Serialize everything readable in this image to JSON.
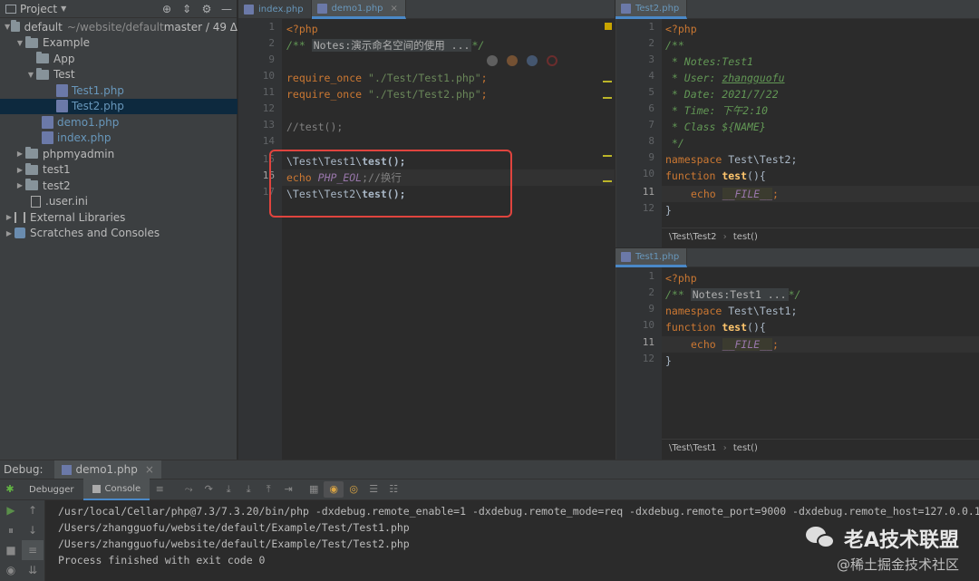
{
  "project": {
    "title": "Project",
    "tree": [
      {
        "label": "default",
        "extra": "~/website/default",
        "branch": "master / 49 Δ",
        "type": "folder",
        "expanded": true
      },
      {
        "label": "Example",
        "type": "folder",
        "expanded": true
      },
      {
        "label": "App",
        "type": "folder"
      },
      {
        "label": "Test",
        "type": "folder",
        "expanded": true
      },
      {
        "label": "Test1.php",
        "type": "php"
      },
      {
        "label": "Test2.php",
        "type": "php",
        "selected": true
      },
      {
        "label": "demo1.php",
        "type": "php"
      },
      {
        "label": "index.php",
        "type": "php"
      },
      {
        "label": "phpmyadmin",
        "type": "folder"
      },
      {
        "label": "test1",
        "type": "folder"
      },
      {
        "label": "test2",
        "type": "folder"
      },
      {
        "label": ".user.ini",
        "type": "ini"
      },
      {
        "label": "External Libraries",
        "type": "lib"
      },
      {
        "label": "Scratches and Consoles",
        "type": "scratch"
      }
    ]
  },
  "left_editor": {
    "tabs": [
      {
        "label": "index.php"
      },
      {
        "label": "demo1.php",
        "active": true
      }
    ],
    "line_numbers": [
      "1",
      "2",
      "9",
      "10",
      "11",
      "12",
      "13",
      "14",
      "15",
      "16",
      "17"
    ],
    "current_line": "16",
    "lines": {
      "l1": "<?php",
      "l2_open": "/**",
      "l2_fold": "Notes:演示命名空间的使用 ...",
      "l2_close": "*/",
      "l10_kw": "require_once",
      "l10_str": "\"./Test/Test1.php\"",
      "l10_end": ";",
      "l11_kw": "require_once",
      "l11_str": "\"./Test/Test2.php\"",
      "l11_end": ";",
      "l13": "//test();",
      "l15_ns": "\\Test\\Test1\\",
      "l15_fn": "test",
      "l15_end": "();",
      "l16_kw": "echo",
      "l16_const": "PHP_EOL",
      "l16_cmt": ";//换行",
      "l17_ns": "\\Test\\Test2\\",
      "l17_fn": "test",
      "l17_end": "();"
    }
  },
  "right_top_editor": {
    "tab": "Test2.php",
    "line_numbers": [
      "1",
      "2",
      "3",
      "4",
      "5",
      "6",
      "7",
      "8",
      "9",
      "10",
      "11",
      "12"
    ],
    "current_line": "11",
    "lines": {
      "l1": "<?php",
      "l2": "/**",
      "l3": " * Notes:Test1",
      "l4a": " * User: ",
      "l4b": "zhangguofu",
      "l5": " * Date: 2021/7/22",
      "l6": " * Time: 下午2:10",
      "l7": " * Class ${NAME}",
      "l8": " */",
      "l9_kw": "namespace",
      "l9_rest": " Test\\Test2;",
      "l10_kw": "function",
      "l10_fn": "test",
      "l10_rest": "(){",
      "l11_kw": "echo",
      "l11_const": "__FILE__",
      "l11_end": ";",
      "l12": "}"
    },
    "breadcrumb_ns": "\\Test\\Test2",
    "breadcrumb_fn": "test()"
  },
  "right_bottom_editor": {
    "tab": "Test1.php",
    "line_numbers": [
      "1",
      "2",
      "9",
      "10",
      "11",
      "12"
    ],
    "current_line": "11",
    "lines": {
      "l1": "<?php",
      "l2_open": "/**",
      "l2_fold": "Notes:Test1 ...",
      "l2_close": "*/",
      "l9_kw": "namespace",
      "l9_rest": " Test\\Test1;",
      "l10_kw": "function",
      "l10_fn": "test",
      "l10_rest": "(){",
      "l11_kw": "echo",
      "l11_const": "__FILE__",
      "l11_end": ";",
      "l12": "}"
    },
    "breadcrumb_ns": "\\Test\\Test1",
    "breadcrumb_fn": "test()"
  },
  "debug": {
    "label": "Debug:",
    "session_tab": "demo1.php",
    "tabs": [
      {
        "label": "Debugger"
      },
      {
        "label": "Console",
        "active": true
      }
    ],
    "console_lines": [
      "/usr/local/Cellar/php@7.3/7.3.20/bin/php -dxdebug.remote_enable=1 -dxdebug.remote_mode=req -dxdebug.remote_port=9000 -dxdebug.remote_host=127.0.0.1",
      "/Users/zhangguofu/website/default/Example/Test/Test1.php",
      "/Users/zhangguofu/website/default/Example/Test/Test2.php",
      "Process finished with exit code 0"
    ]
  },
  "watermark": {
    "main": "老A技术联盟",
    "sub": "@稀土掘金技术社区"
  },
  "colors": {
    "editor_bg": "#2b2b2b",
    "panel_bg": "#3c3f41",
    "keyword": "#cc7832",
    "string": "#6a8759",
    "doc_comment": "#629755",
    "constant": "#9876aa",
    "highlight_box": "#e0443e"
  }
}
